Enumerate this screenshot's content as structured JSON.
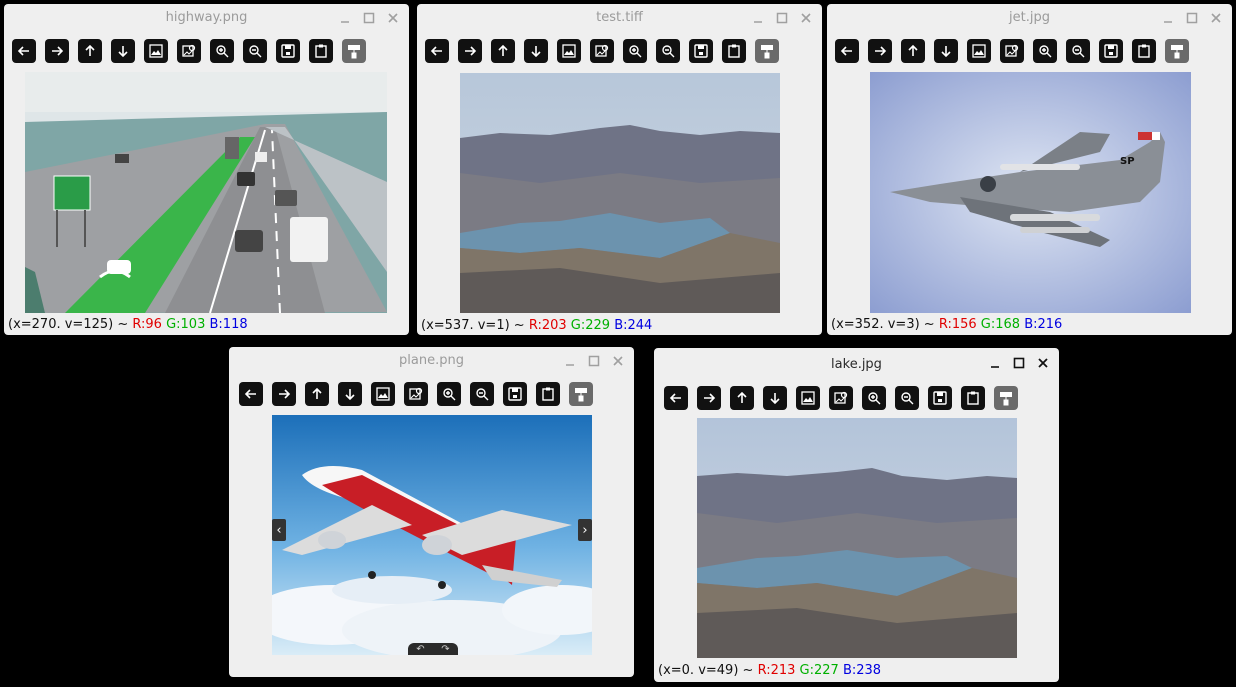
{
  "windows": [
    {
      "title": "highway.png",
      "status": {
        "coord": "(x=270. v=125) ~ ",
        "r": "R:96",
        "g": "G:103",
        "b": "B:118"
      }
    },
    {
      "title": "test.tiff",
      "status": {
        "coord": "(x=537. v=1) ~ ",
        "r": "R:203",
        "g": "G:229",
        "b": "B:244"
      }
    },
    {
      "title": "jet.jpg",
      "status": {
        "coord": "(x=352. v=3) ~ ",
        "r": "R:156",
        "g": "G:168",
        "b": "B:216"
      }
    },
    {
      "title": "plane.png",
      "status": {
        "coord": "",
        "r": "",
        "g": "",
        "b": ""
      }
    },
    {
      "title": "lake.jpg",
      "status": {
        "coord": "(x=0. v=49) ~ ",
        "r": "R:213",
        "g": "G:227",
        "b": "B:238"
      }
    }
  ],
  "toolbar_icons": [
    "arrow-left-icon",
    "arrow-right-icon",
    "arrow-up-icon",
    "arrow-down-icon",
    "image-icon",
    "image-search-icon",
    "zoom-in-icon",
    "zoom-out-icon",
    "save-icon",
    "clipboard-icon",
    "paint-roller-icon"
  ],
  "plane_nav": {
    "prev": "‹",
    "next": "›",
    "rotate_left": "↶",
    "rotate_right": "↷"
  },
  "colors": {
    "red": "#e00000",
    "green": "#00b000",
    "blue": "#0000e0",
    "toolbar": "#111111",
    "window": "#efefef"
  },
  "jet_marking": "SP"
}
